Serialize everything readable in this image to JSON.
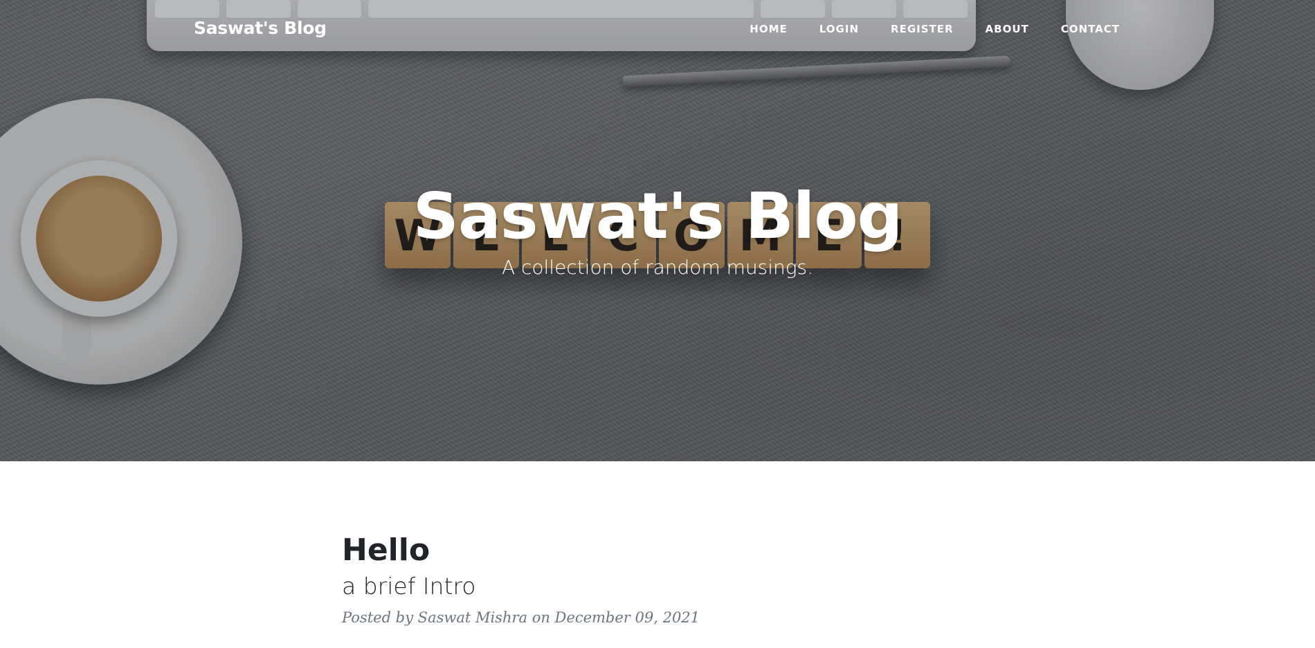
{
  "navbar": {
    "brand": "Saswat's Blog",
    "links": [
      "HOME",
      "LOGIN",
      "REGISTER",
      "ABOUT",
      "CONTACT"
    ]
  },
  "hero": {
    "title": "Saswat's Blog",
    "subtitle": "A collection of random musings.",
    "background_blocks": [
      "W",
      "E",
      "L",
      "C",
      "O",
      "M",
      "E",
      "!"
    ]
  },
  "post": {
    "title": "Hello",
    "subtitle": "a brief Intro",
    "meta": "Posted by Saswat Mishra on December 09, 2021"
  },
  "colors": {
    "text_dark": "#212529",
    "meta_gray": "#6c757d",
    "hero_overlay": "#6e6f73"
  }
}
